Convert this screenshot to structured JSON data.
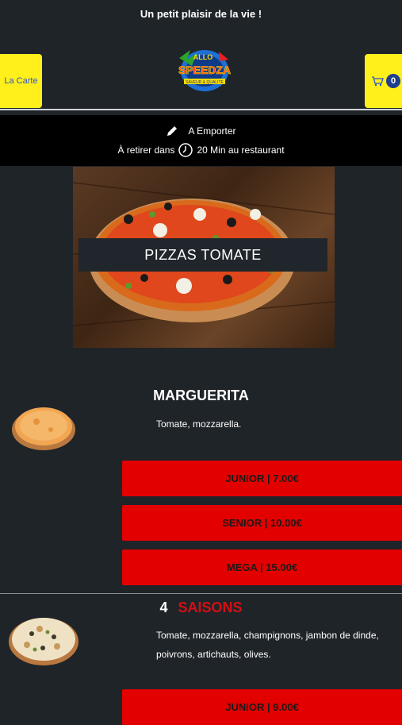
{
  "header": {
    "tagline": "Un petit plaisir de la vie !",
    "menu_label": "La Carte",
    "cart_icon": "cart-icon",
    "cart_count": "0",
    "logo_text": "ALLO SPEEDZA",
    "logo_subtext": "SAVEUR & QUALITÉ"
  },
  "order": {
    "mode_icon": "pencil-icon",
    "mode": "A Emporter",
    "pickup_prefix": "À retirer dans",
    "clock_icon": "clock-icon",
    "pickup_time": "20 Min au restaurant"
  },
  "category": {
    "title": "PIZZAS TOMATE"
  },
  "items": [
    {
      "name": "MARGUERITA",
      "description": "Tomate, mozzarella.",
      "prices": [
        "JUNIOR | 7.00€",
        "SENIOR | 10.00€",
        "MEGA | 15.00€"
      ]
    },
    {
      "name_part1": "4",
      "name_part2": "SAISONS",
      "description_line1": "Tomate, mozzarella, champignons, jambon de dinde,",
      "description_line2": "poivrons, artichauts, olives.",
      "prices": [
        "JUNIOR | 9.00€"
      ]
    }
  ],
  "colors": {
    "background": "#1f2429",
    "accent_yellow": "#ffef1a",
    "price_red": "#e30000",
    "title_red": "#d40f14"
  }
}
